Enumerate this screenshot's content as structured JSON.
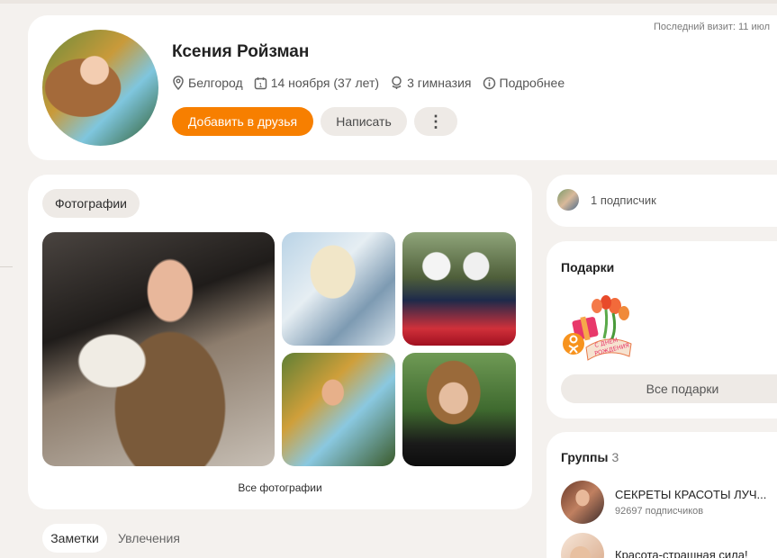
{
  "profile": {
    "last_visit": "Последний визит: 11 июл",
    "name": "Ксения Ройзман",
    "city": "Белгород",
    "birthday": "14 ноября (37 лет)",
    "school": "3 гимназия",
    "more": "Подробнее",
    "add_friend": "Добавить в друзья",
    "write": "Написать",
    "more_menu": "⋮"
  },
  "photos": {
    "chip": "Фотографии",
    "all_photos": "Все фотографии"
  },
  "tabs": {
    "notes": "Заметки",
    "hobbies": "Увлечения"
  },
  "subscribers": {
    "text": "1 подписчик"
  },
  "gifts": {
    "title": "Подарки",
    "gift_text_1": "С ДНЁМ",
    "gift_text_2": "РОЖДЕНИЯ",
    "all_gifts": "Все подарки"
  },
  "groups": {
    "title": "Группы",
    "count": "3",
    "items": [
      {
        "name": "СЕКРЕТЫ КРАСОТЫ ЛУЧ...",
        "subscribers": "92697 подписчиков"
      },
      {
        "name": "Красота-страшная сила!",
        "subscribers": ""
      }
    ]
  },
  "colors": {
    "accent": "#f77f00",
    "background": "#f4f1ee",
    "card": "#ffffff",
    "chip": "#eeeae6"
  }
}
